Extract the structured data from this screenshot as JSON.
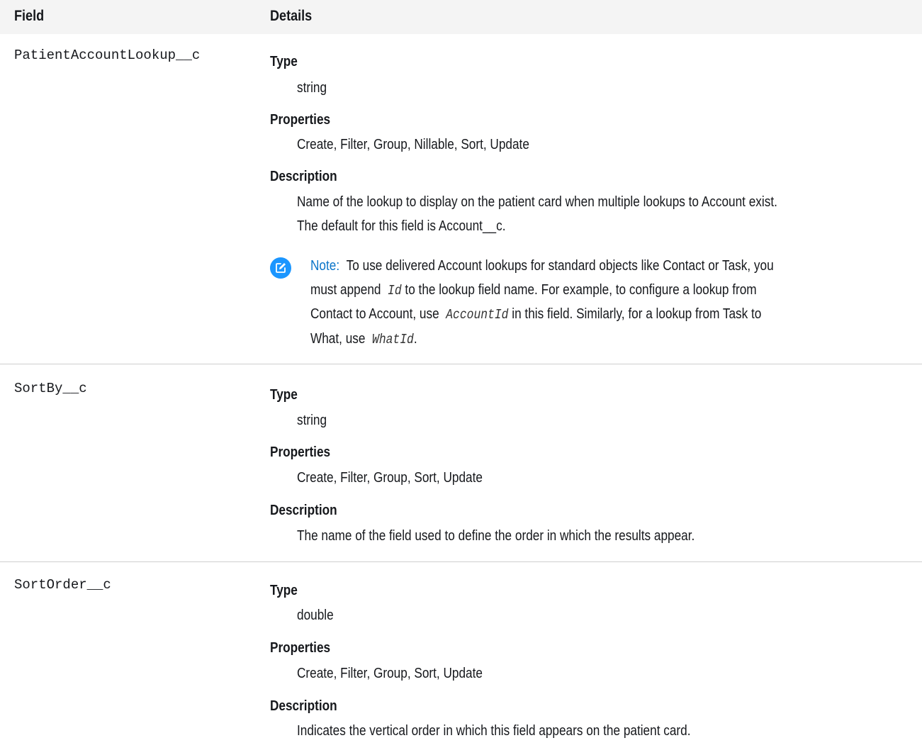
{
  "header": {
    "field": "Field",
    "details": "Details"
  },
  "rows": [
    {
      "field": "PatientAccountLookup__c",
      "type_label": "Type",
      "type_value": "string",
      "properties_label": "Properties",
      "properties_value": "Create, Filter, Group, Nillable, Sort, Update",
      "description_label": "Description",
      "description_lines": [
        "Name of the lookup to display on the patient card when multiple lookups to Account exist.",
        "The default for this field is Account__c."
      ],
      "note": {
        "label": "Note:",
        "line1": "To use delivered Account lookups for standard objects like Contact or Task, you",
        "line2_pre": "must append ",
        "line2_code": "Id",
        "line2_post": " to the lookup field name. For example, to configure a lookup from",
        "line3_pre": "Contact to Account, use ",
        "line3_code": "AccountId",
        "line3_post": " in this field. Similarly, for a lookup from Task to",
        "line4_pre": "What, use ",
        "line4_code": "WhatId",
        "line4_post": "."
      }
    },
    {
      "field": "SortBy__c",
      "type_label": "Type",
      "type_value": "string",
      "properties_label": "Properties",
      "properties_value": "Create, Filter, Group, Sort, Update",
      "description_label": "Description",
      "description_lines": [
        "The name of the field used to define the order in which the results appear."
      ]
    },
    {
      "field": "SortOrder__c",
      "type_label": "Type",
      "type_value": "double",
      "properties_label": "Properties",
      "properties_value": "Create, Filter, Group, Sort, Update",
      "description_label": "Description",
      "description_lines": [
        "Indicates the vertical order in which this field appears on the patient card."
      ]
    }
  ],
  "colors": {
    "header_bg": "#f4f4f4",
    "divider": "#cfcfcf",
    "note_icon": "#1b96ff",
    "note_label": "#0b75c9"
  }
}
